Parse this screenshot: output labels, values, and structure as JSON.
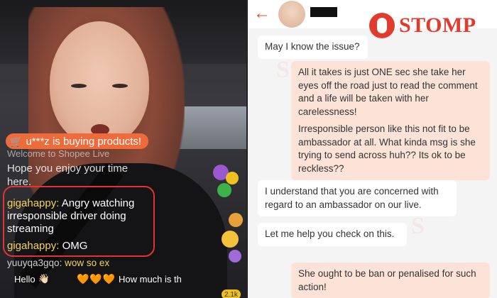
{
  "live": {
    "purchase_notice": "u***z is buying products!",
    "welcome_text": "Welcome to Shopee Live",
    "hope_text": "Hope you enjoy your time here.",
    "comments": [
      {
        "user": "gigahappy:",
        "text": "Angry watching irresponsible driver doing streaming"
      },
      {
        "user": "gigahappy:",
        "text": "OMG"
      },
      {
        "user": "yuuyqa3gqo:",
        "text": "wow so ex"
      }
    ],
    "quick_replies": [
      {
        "label": "Hello",
        "emoji": "👋🏻"
      },
      {
        "label": "",
        "emoji": "🧡🧡🧡"
      },
      {
        "label": "How much is th",
        "emoji": ""
      }
    ],
    "counter": "2.1k"
  },
  "chat": {
    "back_icon": "back-arrow-icon",
    "brand": "STOMP",
    "messages": [
      {
        "side": "left",
        "text": "May I know the issue?"
      },
      {
        "side": "right",
        "text": "All it takes is just ONE sec she take her eyes off the road just to read the comment and a life will be taken with her carelessness!"
      },
      {
        "side": "right",
        "text": "Irresponsible person like this not fit to be ambassador at all. What kinda msg is she trying to send across huh?? Its ok to be reckless??"
      },
      {
        "side": "left",
        "text": "I understand that you are concerned with regard to an ambassador on our live."
      },
      {
        "side": "left",
        "text": "Let me help you check on this."
      },
      {
        "side": "right",
        "text": "She ought to be ban or penalised for such action!"
      }
    ]
  },
  "colors": {
    "accent": "#e23a2c",
    "highlight_box": "#e33333",
    "username": "#f5d35a",
    "buy_pill": "#ee6b3b",
    "bubble_right": "#fde3d7"
  }
}
